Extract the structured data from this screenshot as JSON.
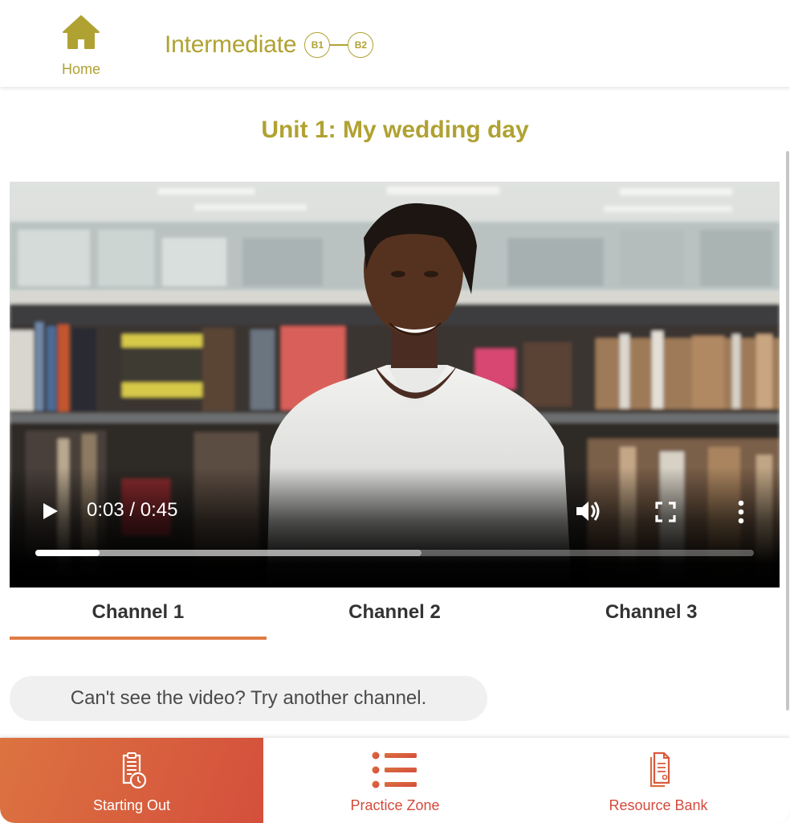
{
  "header": {
    "home_label": "Home",
    "home_icon": "home-icon",
    "level_title": "Intermediate",
    "level_badges": [
      "B1",
      "B2"
    ],
    "brand_color": "#b0a232"
  },
  "unit": {
    "title": "Unit 1: My wedding day"
  },
  "video": {
    "current_time": "0:03",
    "duration": "0:45",
    "time_display": "0:03 / 0:45",
    "played_fraction": 0.089,
    "buffered_fraction": 0.537,
    "controls": {
      "play_icon": "play-icon",
      "volume_icon": "volume-icon",
      "fullscreen_icon": "fullscreen-icon",
      "more_icon": "more-vertical-icon"
    }
  },
  "channels": {
    "tabs": [
      {
        "label": "Channel 1",
        "active": true
      },
      {
        "label": "Channel 2",
        "active": false
      },
      {
        "label": "Channel 3",
        "active": false
      }
    ],
    "accent_color": "#e07b45"
  },
  "notice": {
    "text": "Can't see the video? Try another channel."
  },
  "bottom_nav": {
    "items": [
      {
        "label": "Starting Out",
        "icon": "clipboard-clock-icon",
        "active": true
      },
      {
        "label": "Practice Zone",
        "icon": "list-icon",
        "active": false
      },
      {
        "label": "Resource Bank",
        "icon": "documents-icon",
        "active": false
      }
    ],
    "accent_color": "#d44a3c"
  }
}
